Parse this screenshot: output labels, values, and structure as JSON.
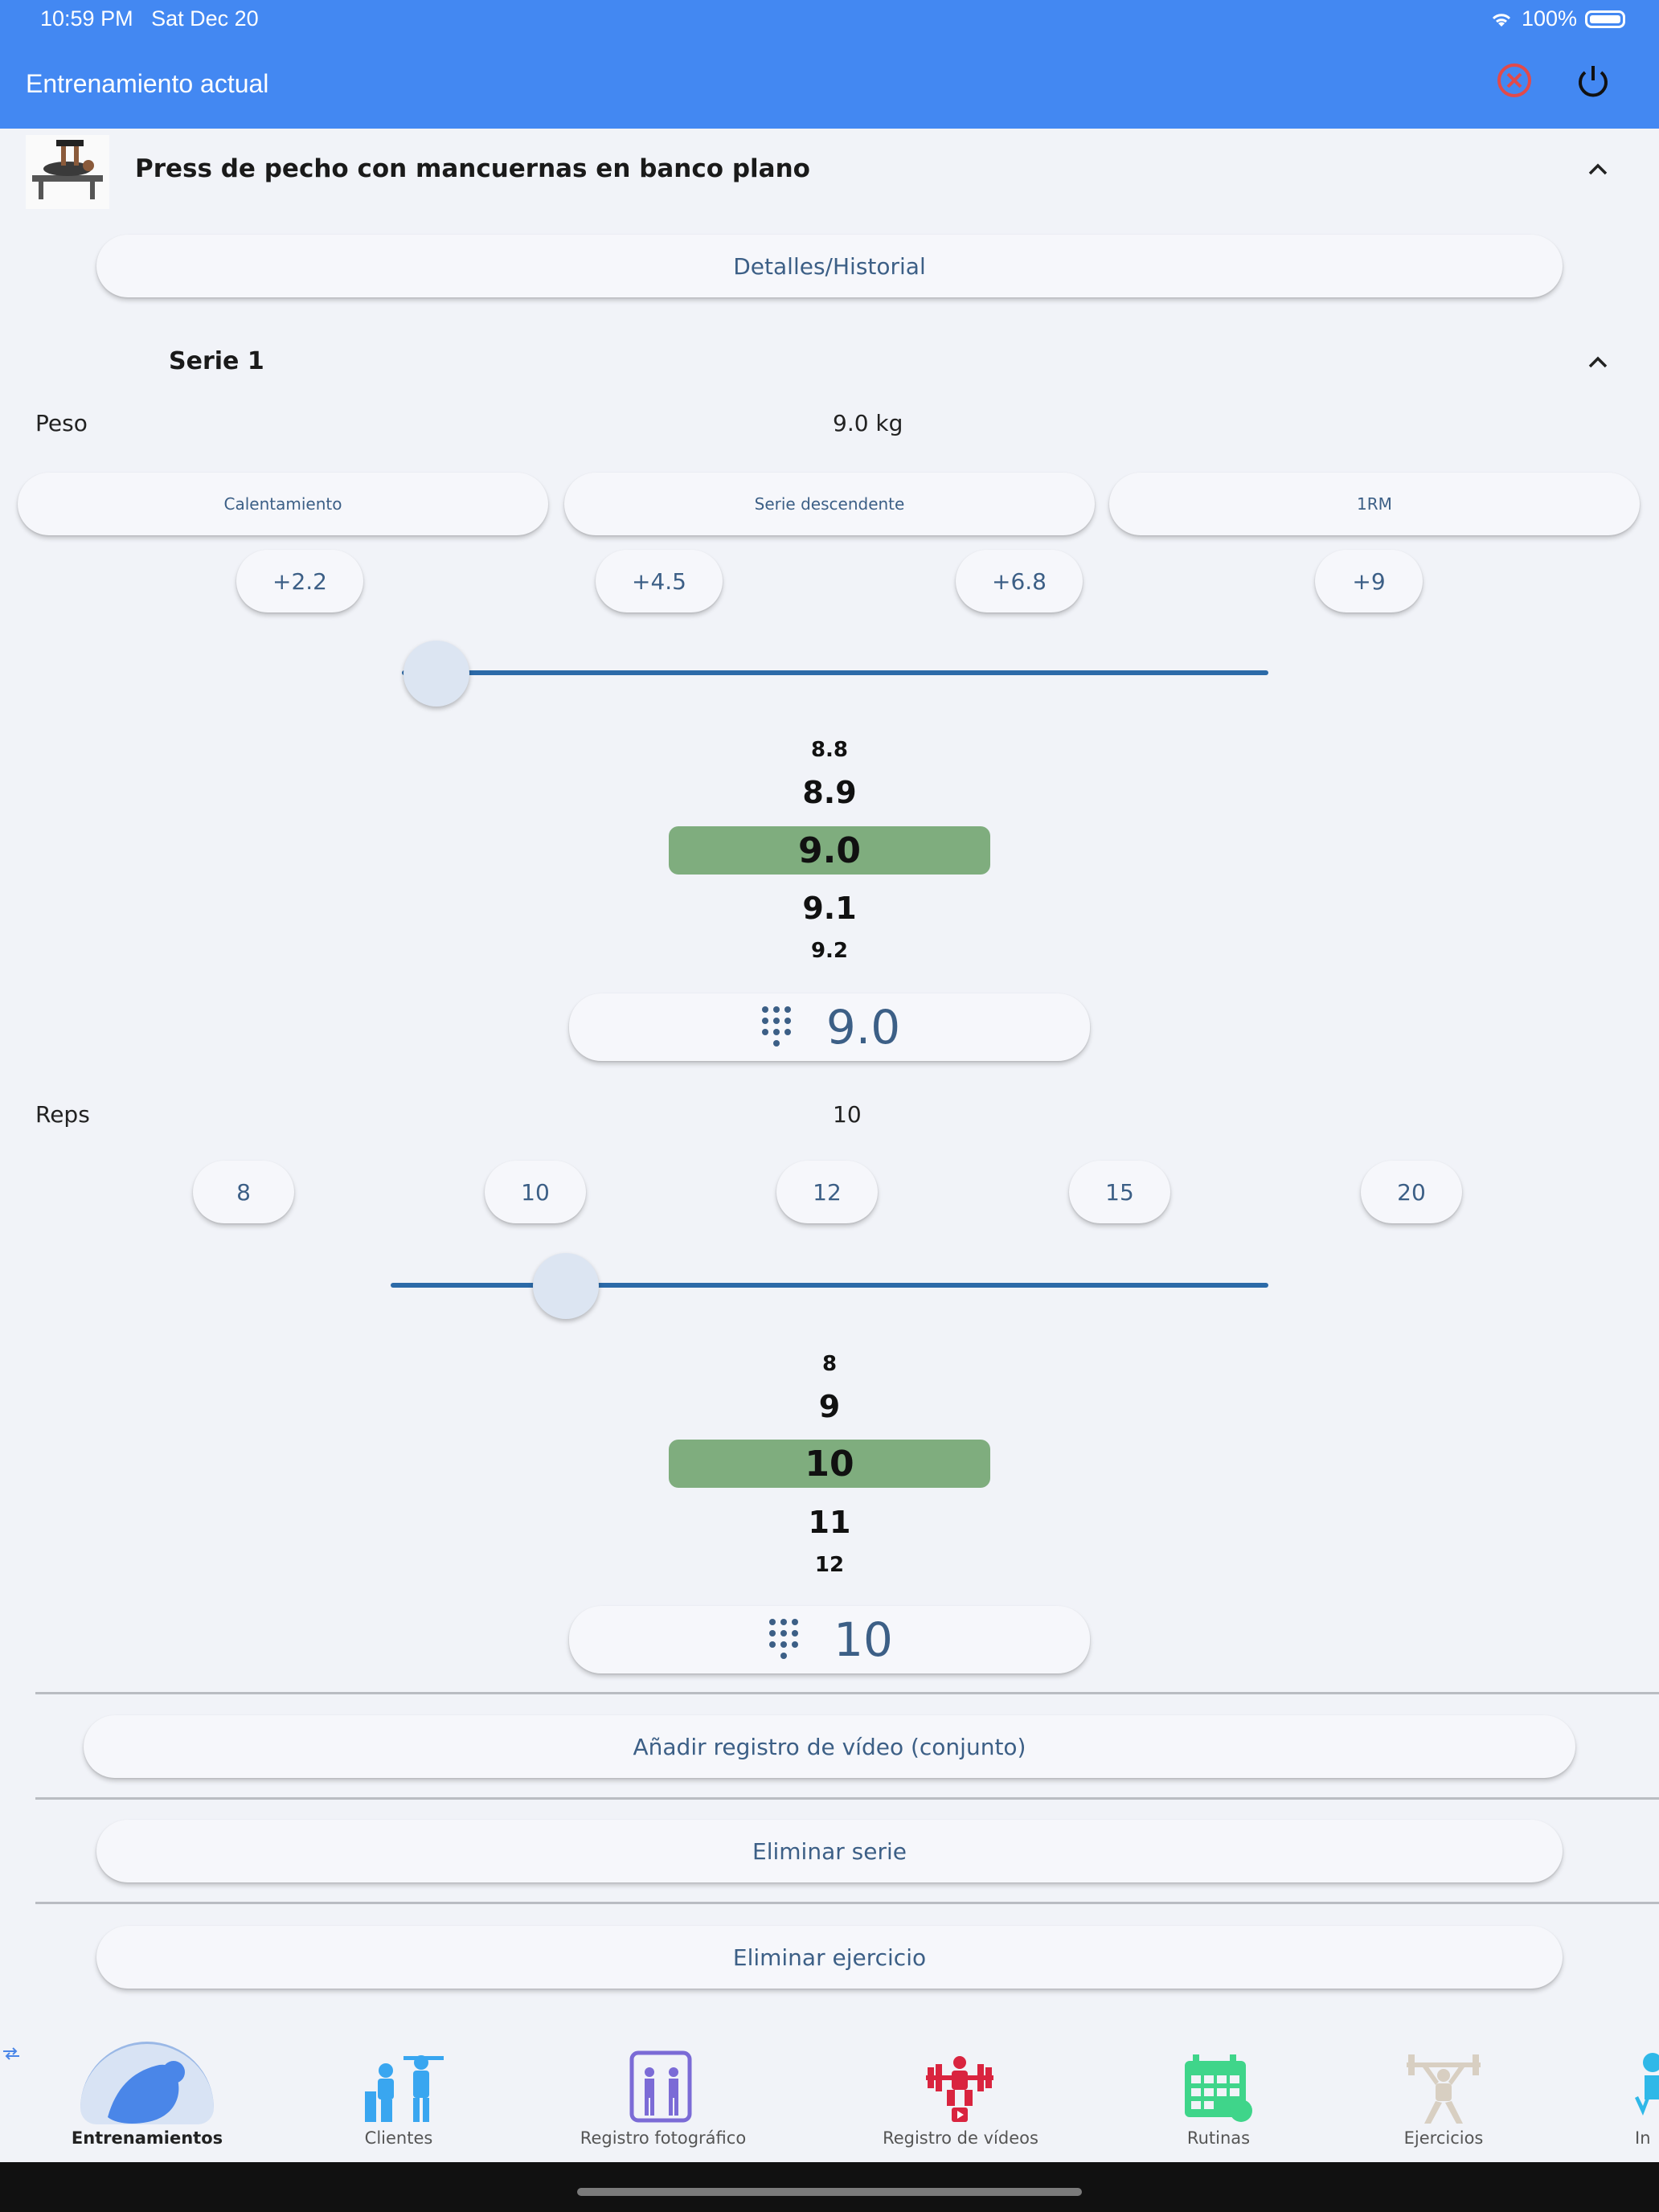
{
  "status_bar": {
    "time": "10:59 PM",
    "date": "Sat Dec 20",
    "battery": "100%"
  },
  "app_bar": {
    "title": "Entrenamiento actual"
  },
  "exercise": {
    "name": "Press de pecho con mancuernas en banco plano",
    "details_button": "Detalles/Historial"
  },
  "set": {
    "title": "Serie 1",
    "weight": {
      "label": "Peso",
      "value_text": "9.0 kg",
      "mode_buttons": [
        "Calentamiento",
        "Serie descendente",
        "1RM"
      ],
      "increments": [
        "+2.2",
        "+4.5",
        "+6.8",
        "+9"
      ],
      "slider_fraction": 0.04,
      "picker": {
        "above2": "8.8",
        "above1": "8.9",
        "selected": "9.0",
        "below1": "9.1",
        "below2": "9.2"
      },
      "keypad_value": "9.0"
    },
    "reps": {
      "label": "Reps",
      "value_text": "10",
      "quick_values": [
        "8",
        "10",
        "12",
        "15",
        "20"
      ],
      "slider_fraction": 0.2,
      "picker": {
        "above2": "8",
        "above1": "9",
        "selected": "10",
        "below1": "11",
        "below2": "12"
      },
      "keypad_value": "10"
    }
  },
  "actions": {
    "add_video": "Añadir registro de vídeo (conjunto)",
    "delete_set": "Eliminar serie",
    "delete_exercise": "Eliminar ejercicio"
  },
  "bottom_nav": {
    "items": [
      {
        "label": "Entrenamientos",
        "icon": "muscle-arm-icon",
        "color": "#4a86e8",
        "active": true
      },
      {
        "label": "Clientes",
        "icon": "trainer-clients-icon",
        "color": "#39a6f0"
      },
      {
        "label": "Registro fotográfico",
        "icon": "photo-log-icon",
        "color": "#7b6bd6"
      },
      {
        "label": "Registro de vídeos",
        "icon": "weightlifter-video-icon",
        "color": "#d9243f"
      },
      {
        "label": "Rutinas",
        "icon": "calendar-routine-icon",
        "color": "#3fd58a"
      },
      {
        "label": "Ejercicios",
        "icon": "barbell-lifter-icon",
        "color": "#d8cfc2"
      },
      {
        "label": "In",
        "icon": "info-person-icon",
        "color": "#2fb8e8"
      }
    ]
  },
  "colors": {
    "app_bar": "#4388f2",
    "picker_selected": "#7fad7e",
    "accent_text": "#3c5f86",
    "slider_track": "#2c6aa8"
  }
}
